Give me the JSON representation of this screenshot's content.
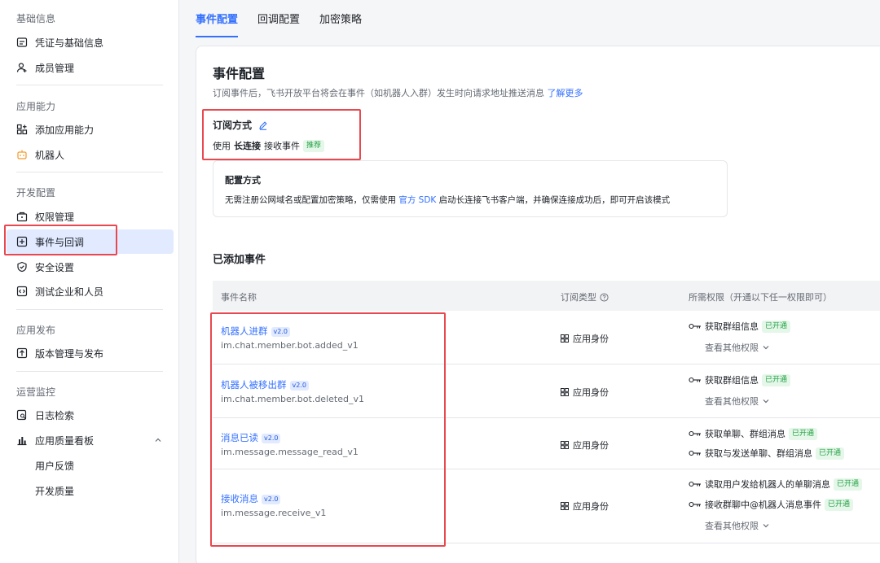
{
  "sidebar": {
    "sections": [
      {
        "title": "基础信息",
        "items": [
          {
            "label": "凭证与基础信息",
            "icon": "credential-icon"
          },
          {
            "label": "成员管理",
            "icon": "member-icon"
          }
        ]
      },
      {
        "title": "应用能力",
        "items": [
          {
            "label": "添加应用能力",
            "icon": "add-capability-icon"
          },
          {
            "label": "机器人",
            "icon": "bot-icon"
          }
        ]
      },
      {
        "title": "开发配置",
        "items": [
          {
            "label": "权限管理",
            "icon": "permission-icon"
          },
          {
            "label": "事件与回调",
            "icon": "event-icon",
            "active": true
          },
          {
            "label": "安全设置",
            "icon": "shield-icon"
          },
          {
            "label": "测试企业和人员",
            "icon": "test-icon"
          }
        ]
      },
      {
        "title": "应用发布",
        "items": [
          {
            "label": "版本管理与发布",
            "icon": "publish-icon"
          }
        ]
      },
      {
        "title": "运营监控",
        "items": [
          {
            "label": "日志检索",
            "icon": "log-search-icon"
          },
          {
            "label": "应用质量看板",
            "icon": "chart-icon",
            "expanded": true
          },
          {
            "label": "用户反馈"
          },
          {
            "label": "开发质量"
          }
        ]
      }
    ]
  },
  "tabs": [
    {
      "label": "事件配置",
      "active": true
    },
    {
      "label": "回调配置"
    },
    {
      "label": "加密策略"
    }
  ],
  "main": {
    "title": "事件配置",
    "desc": "订阅事件后，飞书开放平台将会在事件（如机器人入群）发生时向请求地址推送消息",
    "learn_more": "了解更多",
    "sub_method": {
      "title": "订阅方式",
      "prefix": "使用",
      "method": "长连接",
      "suffix": "接收事件",
      "tag": "推荐"
    },
    "config": {
      "title": "配置方式",
      "desc_pre": "无需注册公网域名或配置加密策略，仅需使用",
      "sdk_link": "官方 SDK",
      "desc_post": "启动长连接飞书客户端，并确保连接成功后，即可开启该模式"
    },
    "added_title": "已添加事件",
    "table": {
      "headers": {
        "name": "事件名称",
        "type": "订阅类型",
        "perm": "所需权限（开通以下任一权限即可）"
      },
      "rows": [
        {
          "name": "机器人进群",
          "version": "v2.0",
          "id": "im.chat.member.bot.added_v1",
          "type": "应用身份",
          "perms": [
            {
              "label": "获取群组信息",
              "status": "已开通"
            }
          ],
          "more": "查看其他权限"
        },
        {
          "name": "机器人被移出群",
          "version": "v2.0",
          "id": "im.chat.member.bot.deleted_v1",
          "type": "应用身份",
          "perms": [
            {
              "label": "获取群组信息",
              "status": "已开通"
            }
          ],
          "more": "查看其他权限"
        },
        {
          "name": "消息已读",
          "version": "v2.0",
          "id": "im.message.message_read_v1",
          "type": "应用身份",
          "perms": [
            {
              "label": "获取单聊、群组消息",
              "status": "已开通"
            },
            {
              "label": "获取与发送单聊、群组消息",
              "status": "已开通"
            }
          ]
        },
        {
          "name": "接收消息",
          "version": "v2.0",
          "id": "im.message.receive_v1",
          "type": "应用身份",
          "perms": [
            {
              "label": "读取用户发给机器人的单聊消息",
              "status": "已开通"
            },
            {
              "label": "接收群聊中@机器人消息事件",
              "status": "已开通"
            }
          ],
          "more": "查看其他权限"
        }
      ]
    }
  },
  "colors": {
    "accent": "#3370ff",
    "highlight": "#e8484f",
    "success": "#24a044"
  }
}
